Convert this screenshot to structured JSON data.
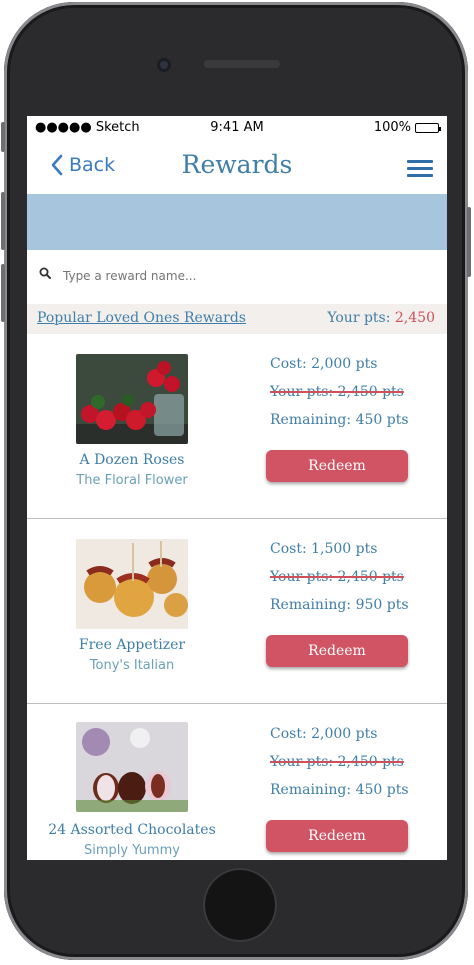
{
  "status": {
    "carrier": "●●●●● Sketch",
    "time": "9:41 AM",
    "battery": "100%"
  },
  "nav": {
    "back": "Back",
    "title": "Rewards"
  },
  "search": {
    "placeholder": "Type a reward name..."
  },
  "section": {
    "title": "Popular Loved Ones Rewards",
    "pts_label": "Your pts:",
    "pts_value": "2,450"
  },
  "rewards": [
    {
      "name": "A Dozen Roses",
      "vendor": "The Floral Flower",
      "cost": "Cost: 2,000 pts",
      "your_pts": "Your pts: 2,450 pts",
      "remaining": "Remaining: 450 pts",
      "button": "Redeem"
    },
    {
      "name": "Free Appetizer",
      "vendor": "Tony's Italian",
      "cost": "Cost: 1,500 pts",
      "your_pts": "Your pts: 2,450 pts",
      "remaining": "Remaining: 950 pts",
      "button": "Redeem"
    },
    {
      "name": "24 Assorted Chocolates",
      "vendor": "Simply Yummy",
      "cost": "Cost: 2,000 pts",
      "your_pts": "Your pts: 2,450 pts",
      "remaining": "Remaining: 450 pts",
      "button": "Redeem"
    }
  ],
  "colors": {
    "primary": "#3f7ea6",
    "accent": "#d05463",
    "banner": "#a7c6dd"
  }
}
